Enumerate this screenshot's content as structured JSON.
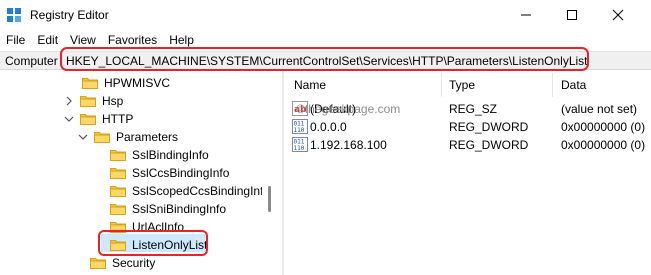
{
  "window": {
    "title": "Registry Editor",
    "controls": {
      "minimize": "minimize-icon",
      "maximize": "maximize-icon",
      "close": "close-icon"
    }
  },
  "menu": [
    "File",
    "Edit",
    "View",
    "Favorites",
    "Help"
  ],
  "address": {
    "label": "Computer",
    "path": "HKEY_LOCAL_MACHINE\\SYSTEM\\CurrentControlSet\\Services\\HTTP\\Parameters\\ListenOnlyList"
  },
  "tree": [
    {
      "label": "HPWMISVC",
      "expander": "none"
    },
    {
      "label": "Hsp",
      "expander": "collapsed"
    },
    {
      "label": "HTTP",
      "expander": "expanded"
    },
    {
      "label": "Parameters",
      "expander": "expanded"
    },
    {
      "label": "SslBindingInfo",
      "expander": "none"
    },
    {
      "label": "SslCcsBindingInfo",
      "expander": "none"
    },
    {
      "label": "SslScopedCcsBindingInfo",
      "expander": "none"
    },
    {
      "label": "SslSniBindingInfo",
      "expander": "none"
    },
    {
      "label": "UrlAclInfo",
      "expander": "none"
    },
    {
      "label": "ListenOnlyList",
      "expander": "none",
      "selected": true
    },
    {
      "label": "Security",
      "expander": "none"
    }
  ],
  "list": {
    "columns": [
      "Name",
      "Type",
      "Data"
    ],
    "rows": [
      {
        "icon": "string-value-icon",
        "name": "(Default)",
        "type": "REG_SZ",
        "data": "(value not set)"
      },
      {
        "icon": "binary-value-icon",
        "name": "0.0.0.0",
        "type": "REG_DWORD",
        "data": "0x00000000 (0)"
      },
      {
        "icon": "binary-value-icon",
        "name": "1.192.168.100",
        "type": "REG_DWORD",
        "data": "0x00000000 (0)"
      }
    ]
  },
  "watermark": "©thegeekpage.com",
  "colors": {
    "highlight": "#e8242a",
    "selection": "#cde8ff",
    "folder": "#f5c542"
  }
}
